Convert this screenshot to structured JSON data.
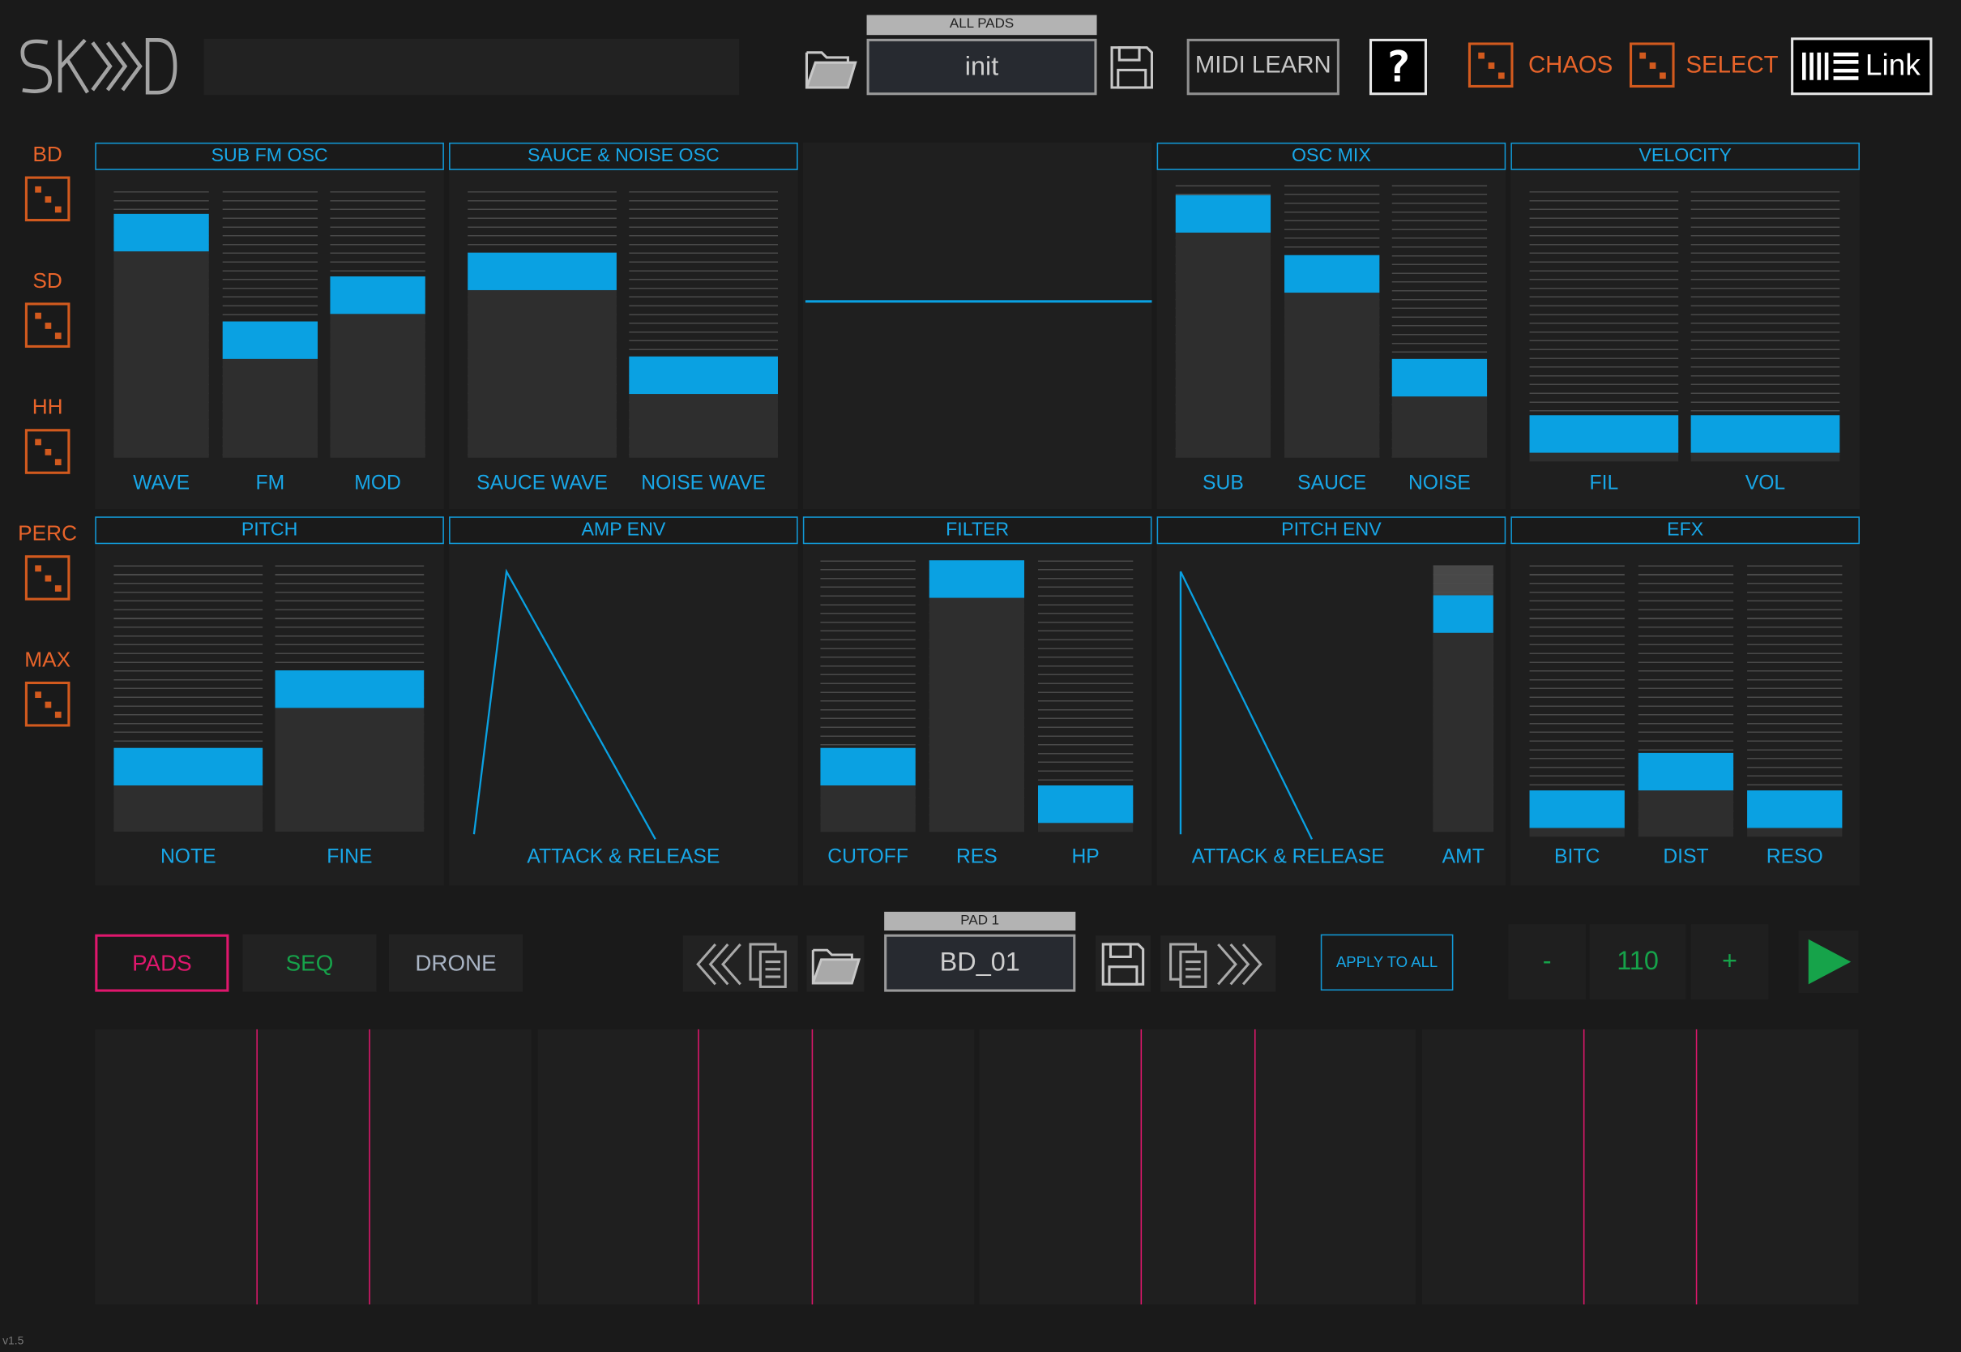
{
  "app": {
    "version": "v1.5"
  },
  "header": {
    "all_pads_caption": "ALL PADS",
    "kit_name": "init",
    "midi_learn": "MIDI LEARN",
    "help_icon": "?",
    "chaos_label": "CHAOS",
    "select_label": "SELECT",
    "link_label": "Link"
  },
  "sidebar": {
    "items": [
      {
        "label": "BD"
      },
      {
        "label": "SD"
      },
      {
        "label": "HH"
      },
      {
        "label": "PERC"
      },
      {
        "label": "MAX"
      }
    ]
  },
  "sections": {
    "sub_fm_osc": {
      "title": "SUB FM OSC",
      "sliders": [
        {
          "label": "WAVE",
          "value": 0.9
        },
        {
          "label": "FM",
          "value": 0.43
        },
        {
          "label": "MOD",
          "value": 0.63
        }
      ]
    },
    "sauce_noise_osc": {
      "title": "SAUCE & NOISE OSC",
      "sliders": [
        {
          "label": "SAUCE WAVE",
          "value": 0.73
        },
        {
          "label": "NOISE WAVE",
          "value": 0.28
        }
      ]
    },
    "osc_mix": {
      "title": "OSC MIX",
      "sliders": [
        {
          "label": "SUB",
          "value": 0.96
        },
        {
          "label": "SAUCE",
          "value": 0.7
        },
        {
          "label": "NOISE",
          "value": 0.26
        }
      ]
    },
    "velocity": {
      "title": "VELOCITY",
      "sliders": [
        {
          "label": "FIL",
          "value": 0.04
        },
        {
          "label": "VOL",
          "value": 0.04
        }
      ]
    },
    "pitch": {
      "title": "PITCH",
      "sliders": [
        {
          "label": "NOTE",
          "value": 0.2
        },
        {
          "label": "FINE",
          "value": 0.54
        }
      ]
    },
    "amp_env": {
      "title": "AMP ENV",
      "label": "ATTACK & RELEASE"
    },
    "filter": {
      "title": "FILTER",
      "sliders": [
        {
          "label": "CUTOFF",
          "value": 0.2
        },
        {
          "label": "RES",
          "value": 1.0
        },
        {
          "label": "HP",
          "value": 0.04
        }
      ]
    },
    "pitch_env": {
      "title": "PITCH ENV",
      "label": "ATTACK & RELEASE",
      "amt": {
        "label": "AMT",
        "value": 0.87
      }
    },
    "efx": {
      "title": "EFX",
      "sliders": [
        {
          "label": "BITC",
          "value": 0.04
        },
        {
          "label": "DIST",
          "value": 0.2
        },
        {
          "label": "RESO",
          "value": 0.04
        }
      ]
    }
  },
  "bottom": {
    "tabs": [
      {
        "label": "PADS",
        "color": "#e0176d"
      },
      {
        "label": "SEQ",
        "color": "#16a34a"
      },
      {
        "label": "DRONE",
        "color": "#a9b4c4"
      }
    ],
    "pad_caption": "PAD 1",
    "pad_name": "BD_01",
    "apply_to_all": "APPLY TO ALL",
    "tempo_minus": "-",
    "tempo_value": "110",
    "tempo_plus": "+"
  },
  "colors": {
    "accent": "#0aa1e2",
    "chaos": "#e8642a",
    "pads": "#e0176d",
    "seq": "#16a34a"
  }
}
